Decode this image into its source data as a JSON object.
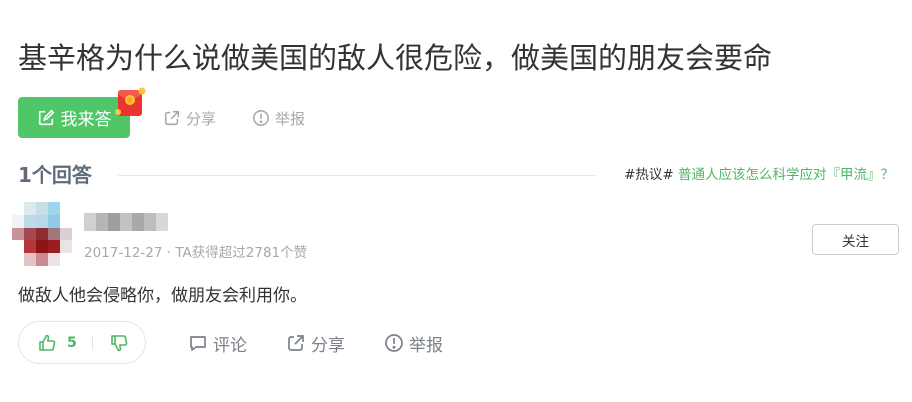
{
  "question": {
    "title": "基辛格为什么说做美国的敌人很危险，做美国的朋友会要命"
  },
  "toolbar": {
    "answer_label": "我来答",
    "share_label": "分享",
    "report_label": "举报"
  },
  "answers_header": {
    "count_label": "1个回答"
  },
  "hot_topic": {
    "tag": "#热议#",
    "text": "普通人应该怎么科学应对『甲流』？"
  },
  "answer": {
    "meta": "2017-12-27 · TA获得超过2781个赞",
    "follow_label": "关注",
    "content": "做敌人他会侵略你，做朋友会利用你。",
    "upvotes": "5",
    "comment_label": "评论",
    "share_label": "分享",
    "report_label": "举报"
  },
  "colors": {
    "accent_green": "#4fc768",
    "link_green": "#4fb567",
    "muted_gray": "#a4a9ae"
  },
  "icons": {
    "answer": "edit-icon",
    "share": "share-icon",
    "report": "report-icon",
    "upvote": "thumbs-up-icon",
    "downvote": "thumbs-down-icon",
    "comment": "comment-icon",
    "redpacket": "red-envelope-icon"
  }
}
